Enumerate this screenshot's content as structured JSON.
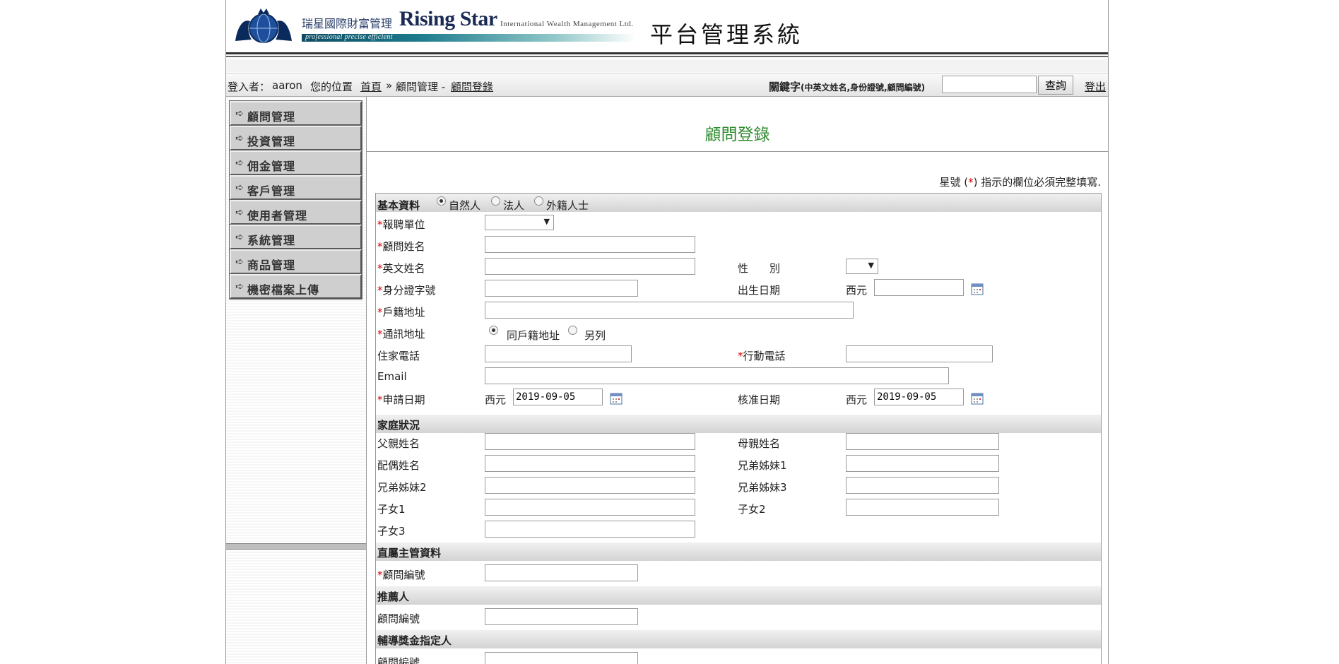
{
  "header": {
    "brand_cn": "瑞星國際財富管理",
    "brand_en": "Rising Star",
    "brand_full": "International Wealth Management Ltd.",
    "brand_slogan": "professional precise efficient",
    "system_title": "平台管理系統"
  },
  "topbar": {
    "login_label": "登入者：",
    "user": "aaron",
    "location_label": "您的位置",
    "home": "首頁",
    "separator": "»",
    "crumb_parent": "顧問管理 -",
    "crumb_current": "顧問登錄",
    "keyword_label": "關鍵字",
    "keyword_hint": "(中英文姓名,身份證號,顧問編號)",
    "keyword_value": "",
    "search_button": "查詢",
    "logout": "登出"
  },
  "sidebar": {
    "items": [
      {
        "label": "顧問管理"
      },
      {
        "label": "投資管理"
      },
      {
        "label": "佣金管理"
      },
      {
        "label": "客戶管理"
      },
      {
        "label": "使用者管理"
      },
      {
        "label": "系統管理"
      },
      {
        "label": "商品管理"
      },
      {
        "label": "機密檔案上傳"
      }
    ]
  },
  "main": {
    "title": "顧問登錄",
    "required_note_pre": "星號 (",
    "required_star": "*",
    "required_note_post": ") 指示的欄位必須完整填寫."
  },
  "form": {
    "basic": {
      "section": "基本資料",
      "type_options": [
        "自然人",
        "法人",
        "外籍人士"
      ],
      "type_selected": "自然人",
      "unit": "報聘單位",
      "name": "顧問姓名",
      "en_name": "英文姓名",
      "gender": "性　　別",
      "id_no": "身分證字號",
      "birth": "出生日期",
      "era": "西元",
      "household_addr": "戶籍地址",
      "mail_addr": "通訊地址",
      "mail_options": [
        "同戶籍地址",
        "另列"
      ],
      "mail_selected": "同戶籍地址",
      "home_phone": "住家電話",
      "mobile": "行動電話",
      "email": "Email",
      "apply_date": "申請日期",
      "apply_date_value": "2019-09-05",
      "approve_date": "核准日期",
      "approve_date_value": "2019-09-05"
    },
    "family": {
      "section": "家庭狀況",
      "father": "父親姓名",
      "mother": "母親姓名",
      "spouse": "配偶姓名",
      "sibling1": "兄弟姊妹1",
      "sibling2": "兄弟姊妹2",
      "sibling3": "兄弟姊妹3",
      "child1": "子女1",
      "child2": "子女2",
      "child3": "子女3"
    },
    "supervisor": {
      "section": "直屬主管資料",
      "advisor_no": "顧問編號"
    },
    "referrer": {
      "section": "推薦人",
      "advisor_no": "顧問編號"
    },
    "mentor": {
      "section": "輔導獎金指定人",
      "advisor_no": "顧問編號"
    }
  },
  "colors": {
    "title_green": "#2e8b2e",
    "required_red": "#d40000",
    "visited_link": "#7a1f8a",
    "brand_navy": "#1a2a55"
  }
}
